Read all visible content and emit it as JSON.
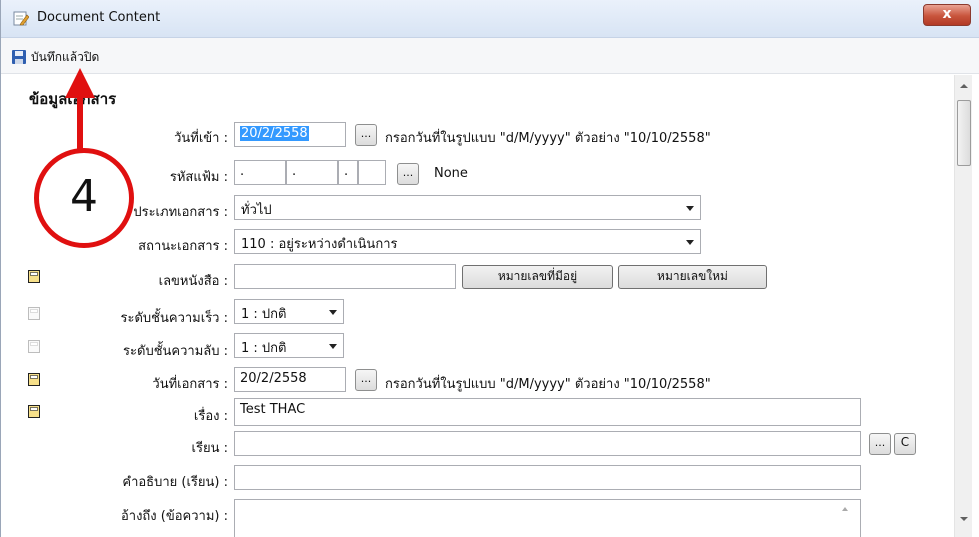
{
  "window": {
    "title": "Document Content",
    "close_label": "x"
  },
  "toolbar": {
    "save_close_label": "บันทึกแล้วปิด"
  },
  "section": {
    "title": "ข้อมูลเอกสาร"
  },
  "fields": {
    "date_in": {
      "label": "วันที่เข้า :",
      "value": "20/2/2558",
      "hint": "กรอกวันที่ในรูปแบบ \"d/M/yyyy\" ตัวอย่าง \"10/10/2558\""
    },
    "file_code": {
      "label": "รหัสแฟ้ม :",
      "parts": [
        ".",
        ".",
        "."
      ],
      "status": "None"
    },
    "doc_type": {
      "label": "ประเภทเอกสาร :",
      "value": "ทั่วไป"
    },
    "doc_status": {
      "label": "สถานะเอกสาร :",
      "value": "110 : อยู่ระหว่างดำเนินการ"
    },
    "doc_number": {
      "label": "เลขหนังสือ :",
      "value": "",
      "btn_existing": "หมายเลขที่มีอยู่",
      "btn_new": "หมายเลขใหม่"
    },
    "urgency": {
      "label": "ระดับชั้นความเร็ว :",
      "value": "1 : ปกติ"
    },
    "secrecy": {
      "label": "ระดับชั้นความลับ :",
      "value": "1 : ปกติ"
    },
    "doc_date": {
      "label": "วันที่เอกสาร :",
      "value": "20/2/2558",
      "hint": "กรอกวันที่ในรูปแบบ \"d/M/yyyy\" ตัวอย่าง \"10/10/2558\""
    },
    "subject": {
      "label": "เรื่อง :",
      "value": "Test THAC"
    },
    "to": {
      "label": "เรียน :",
      "value": "",
      "btn_clear": "C"
    },
    "to_desc": {
      "label": "คำอธิบาย (เรียน) :",
      "value": ""
    },
    "reference": {
      "label": "อ้างถึง (ข้อความ) :",
      "value": ""
    }
  },
  "annotation": {
    "number": "4"
  },
  "colors": {
    "required_marker": "#e8c13a",
    "optional_marker": "#d8d8d8",
    "callout": "#e01010"
  }
}
